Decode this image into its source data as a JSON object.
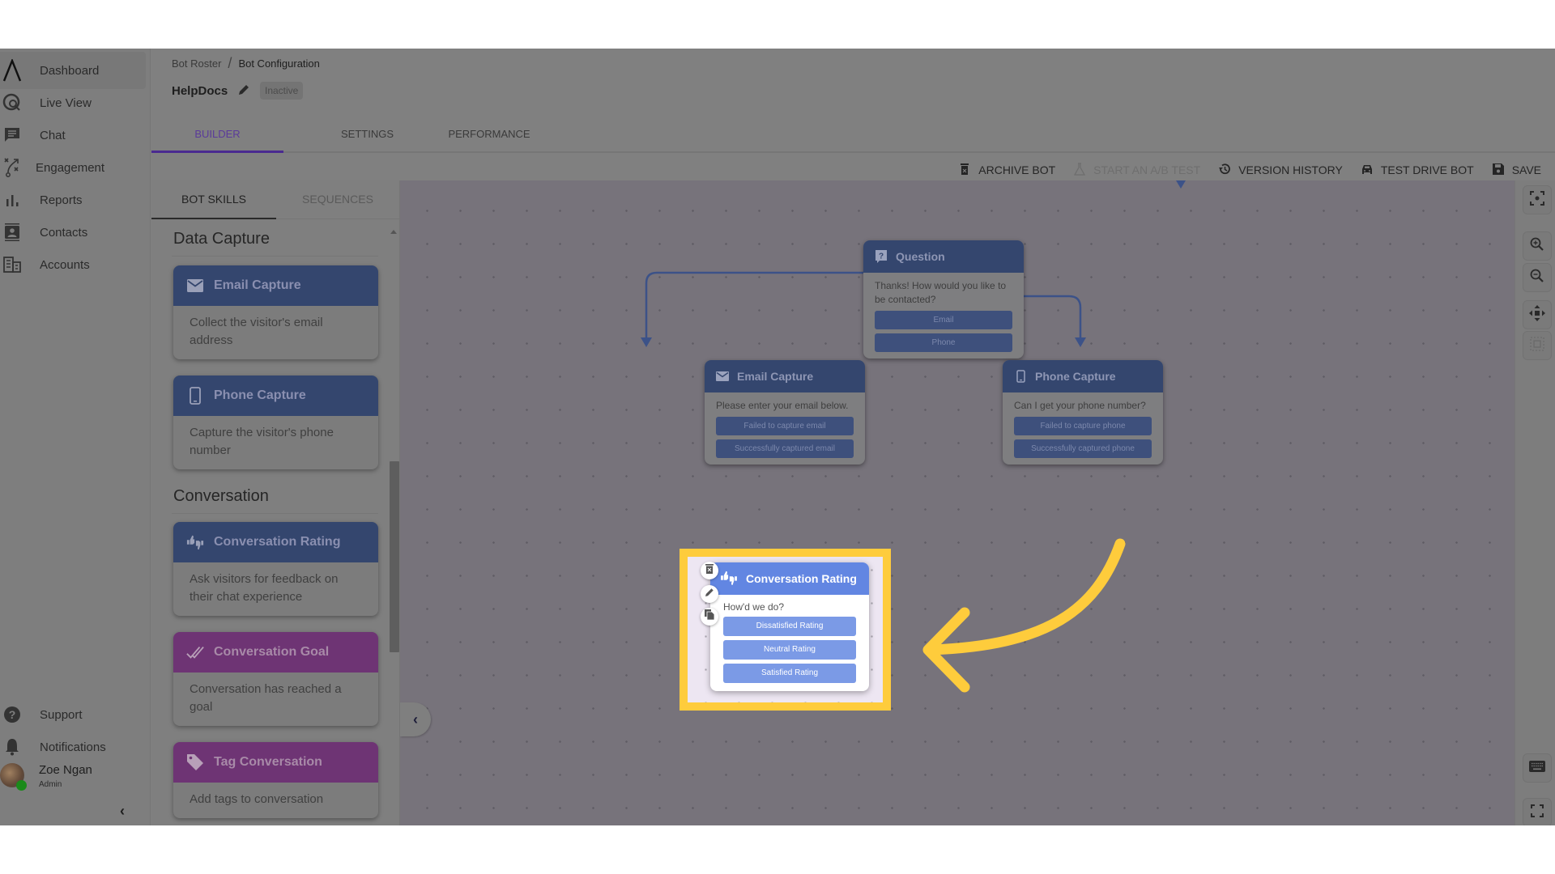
{
  "sidebar": {
    "items": [
      {
        "label": "Dashboard",
        "icon": "logo-caret-icon"
      },
      {
        "label": "Live View",
        "icon": "globe-search-icon"
      },
      {
        "label": "Chat",
        "icon": "chat-icon"
      },
      {
        "label": "Engagement",
        "icon": "strategy-icon"
      },
      {
        "label": "Reports",
        "icon": "bar-chart-icon"
      },
      {
        "label": "Contacts",
        "icon": "contacts-icon"
      },
      {
        "label": "Accounts",
        "icon": "building-icon"
      }
    ],
    "bottom_items": [
      {
        "label": "Support",
        "icon": "help-icon"
      },
      {
        "label": "Notifications",
        "icon": "bell-icon"
      }
    ],
    "user": {
      "name": "Zoe Ngan",
      "role": "Admin"
    },
    "collapse_glyph": "‹"
  },
  "header": {
    "breadcrumb": [
      "Bot Roster",
      "Bot Configuration"
    ],
    "breadcrumb_separator": "/",
    "bot_name": "HelpDocs",
    "status": "Inactive",
    "tabs": [
      {
        "label": "BUILDER",
        "active": true
      },
      {
        "label": "SETTINGS",
        "active": false
      },
      {
        "label": "PERFORMANCE",
        "active": false
      }
    ]
  },
  "toolbar": {
    "archive": "ARCHIVE BOT",
    "ab_test": "START AN A/B TEST",
    "version_history": "VERSION HISTORY",
    "test_drive": "TEST DRIVE BOT",
    "save": "SAVE"
  },
  "panel": {
    "tabs": [
      {
        "label": "BOT SKILLS",
        "active": true
      },
      {
        "label": "SEQUENCES",
        "active": false
      }
    ],
    "sections": [
      {
        "title": "Data Capture",
        "skills": [
          {
            "title": "Email Capture",
            "description": "Collect the visitor's email address",
            "color": "#34466e"
          },
          {
            "title": "Phone Capture",
            "description": "Capture the visitor's phone number",
            "color": "#34466e"
          }
        ]
      },
      {
        "title": "Conversation",
        "skills": [
          {
            "title": "Conversation Rating",
            "description": "Ask visitors for feedback on their chat experience",
            "color": "#34466e"
          },
          {
            "title": "Conversation Goal",
            "description": "Conversation has reached a goal",
            "color": "#6e3474"
          },
          {
            "title": "Tag Conversation",
            "description": "Add tags to conversation",
            "color": "#6e3474"
          }
        ]
      }
    ],
    "collapse_glyph": "‹"
  },
  "canvas": {
    "nodes": {
      "question": {
        "title": "Question",
        "text": "Thanks! How would you like to be contacted?",
        "buttons": [
          "Email",
          "Phone"
        ]
      },
      "email_capture": {
        "title": "Email Capture",
        "text": "Please enter your email below.",
        "buttons": [
          "Failed to capture email",
          "Successfully captured email"
        ]
      },
      "phone_capture": {
        "title": "Phone Capture",
        "text": "Can I get your phone number?",
        "buttons": [
          "Failed to capture phone",
          "Successfully captured phone"
        ]
      },
      "conversation_rating": {
        "title": "Conversation Rating",
        "text": "How'd we do?",
        "buttons": [
          "Dissatisfied Rating",
          "Neutral Rating",
          "Satisfied Rating"
        ]
      }
    },
    "highlight_color": "#fecc3c",
    "node_color": "#6286e2"
  },
  "controls": [
    "recenter",
    "zoom-in",
    "zoom-out",
    "pan",
    "select-area",
    "keyboard",
    "fullscreen"
  ]
}
